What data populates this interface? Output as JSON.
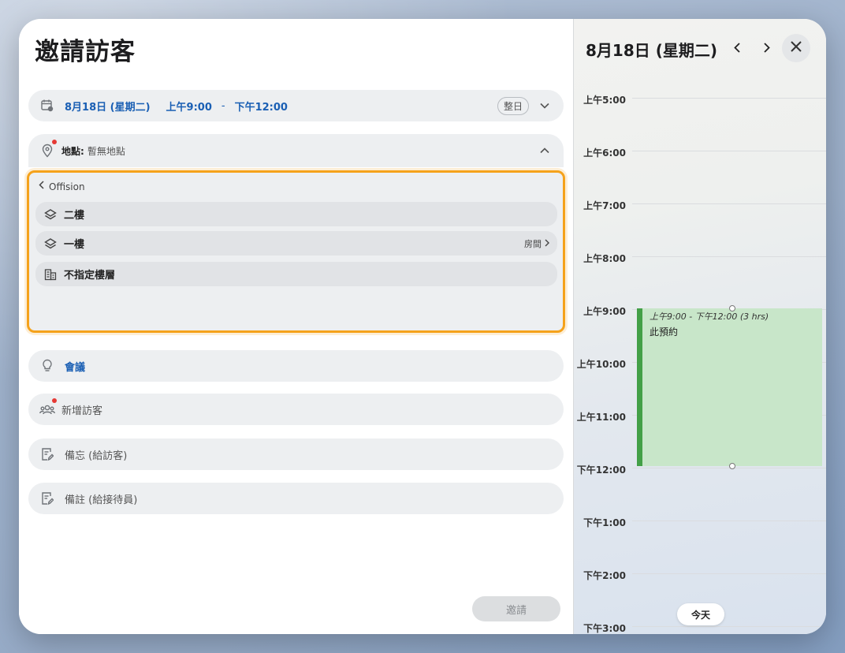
{
  "form": {
    "title": "邀請訪客",
    "date": {
      "date_label": "8月18日 (星期二)",
      "start_time": "上午9:00",
      "separator": "-",
      "end_time": "下午12:00",
      "all_day_label": "整日"
    },
    "location": {
      "label": "地點:",
      "value": "暫無地點"
    },
    "location_picker": {
      "breadcrumb": "Offision",
      "floors": [
        {
          "label": "二樓",
          "icon": "layers-icon",
          "rooms_label": ""
        },
        {
          "label": "一樓",
          "icon": "layers-icon",
          "rooms_label": "房間"
        },
        {
          "label": "不指定樓層",
          "icon": "building-icon",
          "rooms_label": ""
        }
      ]
    },
    "meeting_label": "會議",
    "add_visitor_label": "新增訪客",
    "memo_visitor_placeholder": "備忘 (給訪客)",
    "memo_receptionist_placeholder": "備註 (給接待員)",
    "invite_button": "邀請"
  },
  "calendar": {
    "title": "8月18日 (星期二)",
    "hours": [
      "上午5:00",
      "上午6:00",
      "上午7:00",
      "上午8:00",
      "上午9:00",
      "上午10:00",
      "上午11:00",
      "下午12:00",
      "下午1:00",
      "下午2:00",
      "下午3:00"
    ],
    "event": {
      "time_range": "上午9:00 - 下午12:00 (3 hrs)",
      "name": "此預約"
    },
    "today_button": "今天"
  },
  "colors": {
    "accent_blue": "#1a5fb4",
    "picker_border": "#f5a21b",
    "event_fill": "#c8e6c9",
    "event_bar": "#43a047",
    "required_dot": "#e53935"
  }
}
